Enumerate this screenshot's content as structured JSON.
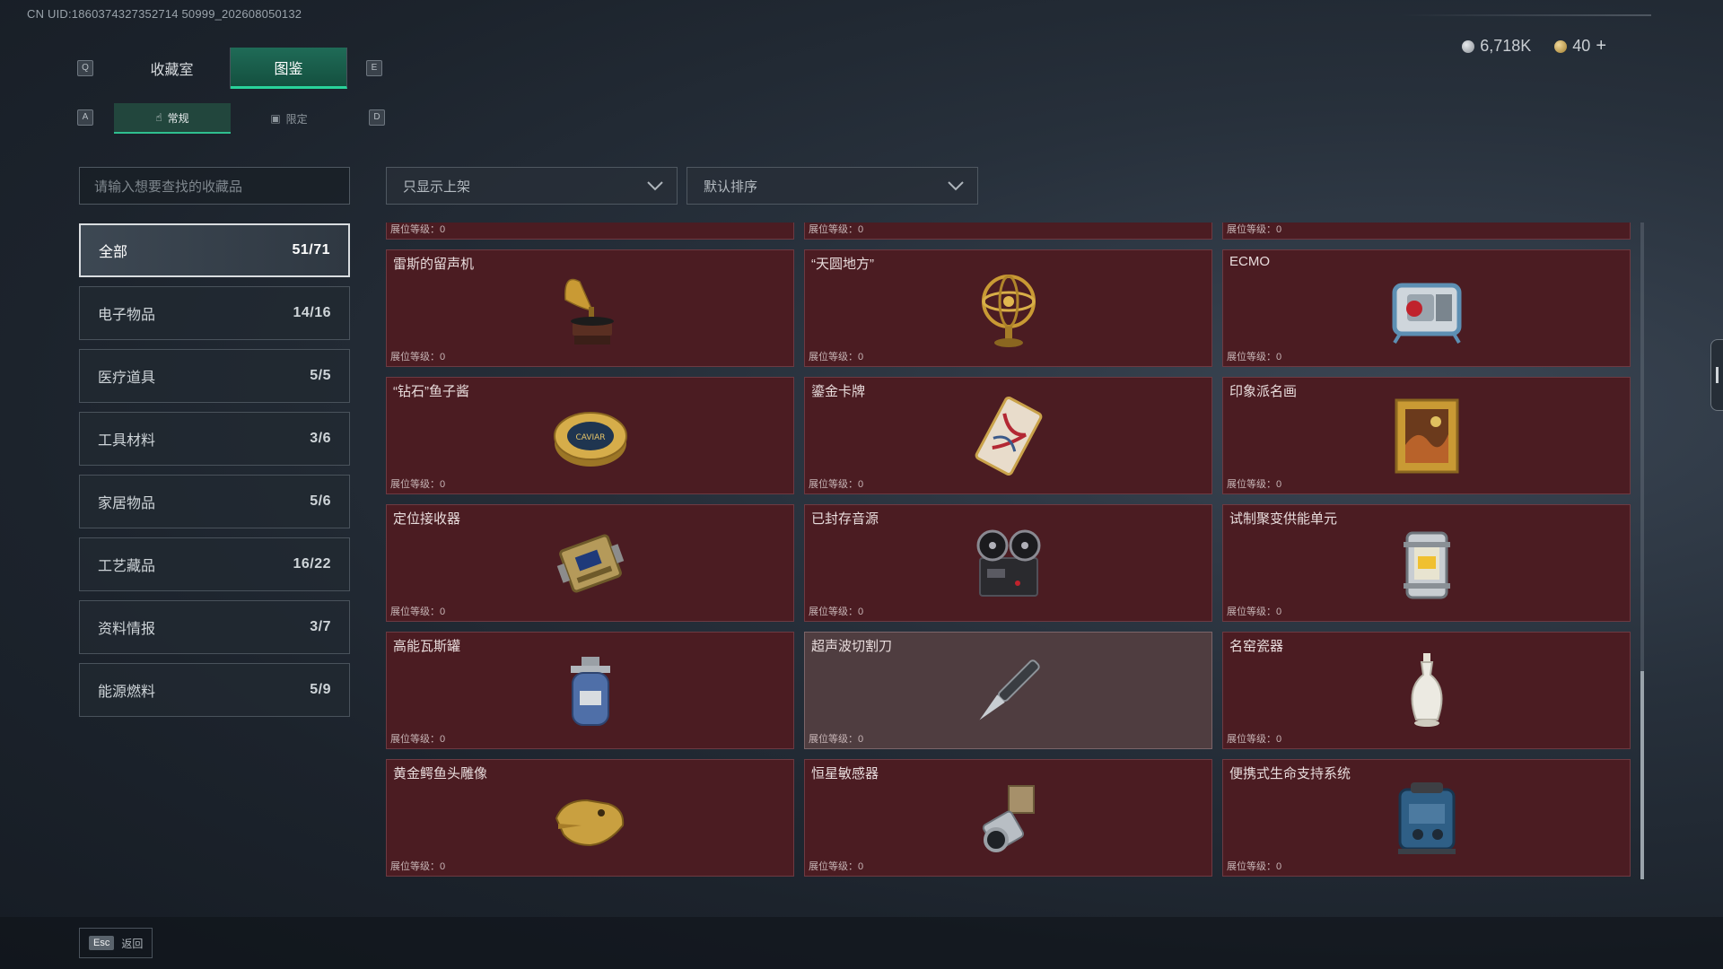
{
  "header": {
    "uid": "CN UID:1860374327352714 50999_202608050132",
    "tabs": [
      {
        "label": "收藏室",
        "active": false
      },
      {
        "label": "图鉴",
        "active": true
      }
    ],
    "left_key": "Q",
    "right_key": "E",
    "subtabs": [
      {
        "label": "常规",
        "icon": "hand-icon",
        "active": true
      },
      {
        "label": "限定",
        "icon": "image-icon",
        "active": false
      }
    ],
    "sub_left_key": "A",
    "sub_right_key": "D",
    "currency": [
      {
        "value": "6,718K",
        "type": "silver-coin"
      },
      {
        "value": "40",
        "type": "gold-coin"
      }
    ],
    "currency_add": "+"
  },
  "search": {
    "placeholder": "请输入想要查找的收藏品"
  },
  "filters": {
    "shelf": "只显示上架",
    "sort": "默认排序"
  },
  "categories": [
    {
      "label": "全部",
      "count": "51/71",
      "active": true
    },
    {
      "label": "电子物品",
      "count": "14/16",
      "active": false
    },
    {
      "label": "医疗道具",
      "count": "5/5",
      "active": false
    },
    {
      "label": "工具材料",
      "count": "3/6",
      "active": false
    },
    {
      "label": "家居物品",
      "count": "5/6",
      "active": false
    },
    {
      "label": "工艺藏品",
      "count": "16/22",
      "active": false
    },
    {
      "label": "资料情报",
      "count": "3/7",
      "active": false
    },
    {
      "label": "能源燃料",
      "count": "5/9",
      "active": false
    }
  ],
  "level_label": "展位等级：0",
  "items": [
    {
      "name": "",
      "art": "partial-item"
    },
    {
      "name": "",
      "art": "partial-item"
    },
    {
      "name": "",
      "art": "partial-item"
    },
    {
      "name": "雷斯的留声机",
      "art": "gramophone"
    },
    {
      "name": "“天圆地方”",
      "art": "armillary"
    },
    {
      "name": "ECMO",
      "art": "ecmo"
    },
    {
      "name": "“钻石”鱼子酱",
      "art": "caviar",
      "art_text": "CAVIAR"
    },
    {
      "name": "鎏金卡牌",
      "art": "card"
    },
    {
      "name": "印象派名画",
      "art": "painting"
    },
    {
      "name": "定位接收器",
      "art": "receiver"
    },
    {
      "name": "已封存音源",
      "art": "reel"
    },
    {
      "name": "试制聚变供能单元",
      "art": "fusion"
    },
    {
      "name": "高能瓦斯罐",
      "art": "gas"
    },
    {
      "name": "超声波切割刀",
      "art": "knife",
      "dim": true
    },
    {
      "name": "名窑瓷器",
      "art": "vase"
    },
    {
      "name": "黄金鳄鱼头雕像",
      "art": "croc"
    },
    {
      "name": "恒星敏感器",
      "art": "sensor"
    },
    {
      "name": "便携式生命支持系统",
      "art": "lifesupport"
    }
  ],
  "footer": {
    "key": "Esc",
    "label": "返回"
  },
  "colors": {
    "accent": "#29d29a",
    "card_bg": "#4b1c22",
    "card_dim_bg": "#4f3d40",
    "panel_bg": "#222931"
  }
}
